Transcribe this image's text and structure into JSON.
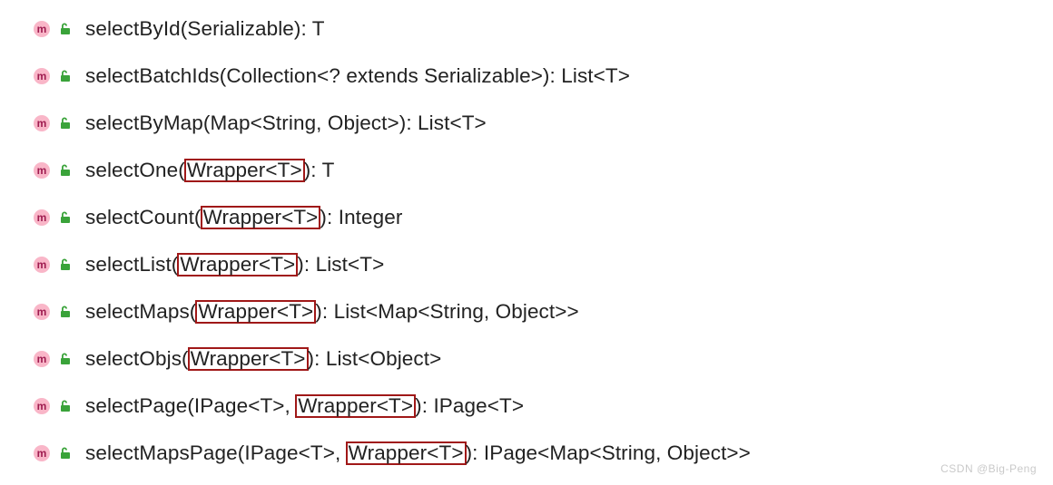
{
  "methods": [
    {
      "prefix": "selectById(Serializable): T",
      "highlighted": "",
      "suffix": ""
    },
    {
      "prefix": "selectBatchIds(Collection<? extends Serializable>): List<T>",
      "highlighted": "",
      "suffix": ""
    },
    {
      "prefix": "selectByMap(Map<String, Object>): List<T>",
      "highlighted": "",
      "suffix": ""
    },
    {
      "prefix": "selectOne(",
      "highlighted": "Wrapper<T>",
      "suffix": "): T"
    },
    {
      "prefix": "selectCount(",
      "highlighted": "Wrapper<T>",
      "suffix": "): Integer"
    },
    {
      "prefix": "selectList(",
      "highlighted": "Wrapper<T>",
      "suffix": "): List<T>"
    },
    {
      "prefix": "selectMaps(",
      "highlighted": "Wrapper<T>",
      "suffix": "): List<Map<String, Object>>"
    },
    {
      "prefix": "selectObjs(",
      "highlighted": "Wrapper<T>",
      "suffix": "): List<Object>"
    },
    {
      "prefix": "selectPage(IPage<T>, ",
      "highlighted": "Wrapper<T>",
      "suffix": "): IPage<T>"
    },
    {
      "prefix": "selectMapsPage(IPage<T>, ",
      "highlighted": "Wrapper<T>",
      "suffix": "): IPage<Map<String, Object>>"
    }
  ],
  "watermark": "CSDN @Big-Peng"
}
